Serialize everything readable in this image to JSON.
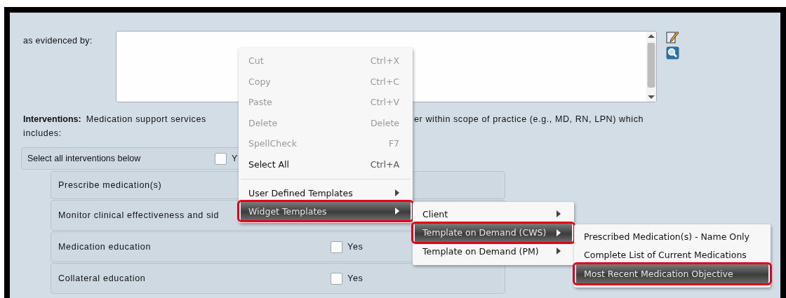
{
  "form": {
    "evidence": {
      "label": "as evidenced by:"
    },
    "interventions": {
      "label": "Interventions:",
      "text_start": "Medication support services",
      "text_end": "er within scope of practice (e.g., MD, RN, LPN) which",
      "text_line_2": "includes:"
    },
    "select_all": {
      "label": "Select all interventions below",
      "checked": false,
      "option": "Y"
    },
    "rows": [
      {
        "label": "Prescribe medication(s)"
      },
      {
        "label": "Monitor clinical effectiveness and sid"
      },
      {
        "label": "Medication education",
        "checked": false,
        "option": "Yes"
      },
      {
        "label": "Collateral education",
        "checked": false,
        "option": "Yes"
      }
    ]
  },
  "context_menu": {
    "items": [
      {
        "kind": "item",
        "label": "Cut",
        "shortcut": "Ctrl+X",
        "disabled": true,
        "submenu": false,
        "selected": false,
        "callout": false
      },
      {
        "kind": "item",
        "label": "Copy",
        "shortcut": "Ctrl+C",
        "disabled": true,
        "submenu": false,
        "selected": false,
        "callout": false
      },
      {
        "kind": "item",
        "label": "Paste",
        "shortcut": "Ctrl+V",
        "disabled": true,
        "submenu": false,
        "selected": false,
        "callout": false
      },
      {
        "kind": "item",
        "label": "Delete",
        "shortcut": "Delete",
        "disabled": true,
        "submenu": false,
        "selected": false,
        "callout": false
      },
      {
        "kind": "item",
        "label": "SpellCheck",
        "shortcut": "F7",
        "disabled": true,
        "submenu": false,
        "selected": false,
        "callout": false
      },
      {
        "kind": "item",
        "label": "Select All",
        "shortcut": "Ctrl+A",
        "disabled": false,
        "submenu": false,
        "selected": false,
        "callout": false
      },
      {
        "kind": "separator"
      },
      {
        "kind": "item",
        "label": "User Defined Templates",
        "disabled": false,
        "submenu": true,
        "selected": false,
        "callout": false
      },
      {
        "kind": "item",
        "label": "Widget Templates",
        "disabled": false,
        "submenu": true,
        "selected": true,
        "callout": true
      }
    ]
  },
  "widget_submenu": {
    "items": [
      {
        "kind": "item",
        "label": "Client",
        "disabled": false,
        "submenu": true,
        "selected": false,
        "callout": false
      },
      {
        "kind": "item",
        "label": "Template on Demand (CWS)",
        "disabled": false,
        "submenu": true,
        "selected": true,
        "callout": true
      },
      {
        "kind": "item",
        "label": "Template on Demand (PM)",
        "disabled": false,
        "submenu": true,
        "selected": false,
        "callout": false
      }
    ]
  },
  "cws_submenu": {
    "items": [
      {
        "kind": "item",
        "label": "Prescribed Medication(s) - Name Only",
        "disabled": false,
        "submenu": false,
        "selected": false,
        "callout": false
      },
      {
        "kind": "item",
        "label": "Complete List of Current Medications",
        "disabled": false,
        "submenu": false,
        "selected": false,
        "callout": false
      },
      {
        "kind": "item",
        "label": "Most Recent Medication Objective",
        "disabled": false,
        "submenu": false,
        "selected": true,
        "callout": true
      }
    ]
  }
}
